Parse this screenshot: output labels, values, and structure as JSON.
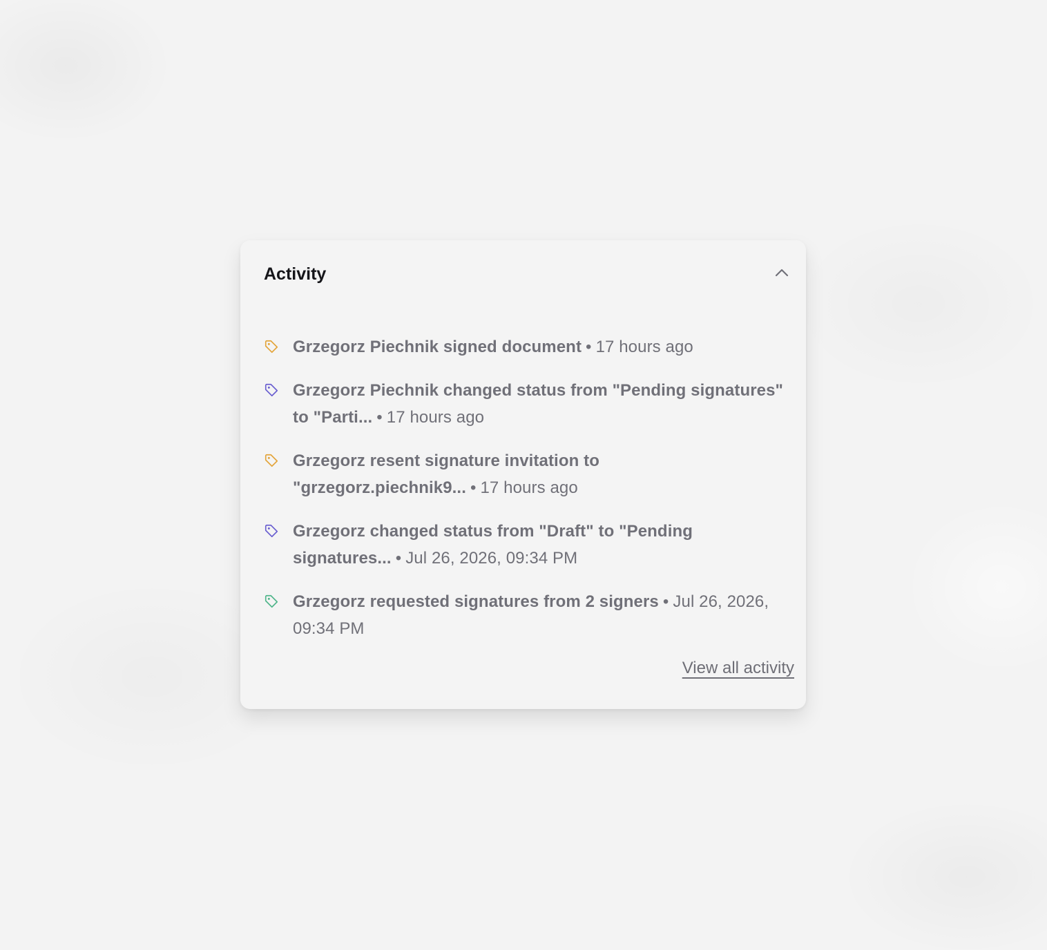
{
  "panel": {
    "title": "Activity",
    "collapse_icon": "chevron-up-icon"
  },
  "activities": [
    {
      "icon": "tag-icon",
      "icon_color": "#e3a43a",
      "action": "Grzegorz Piechnik signed document",
      "time": "17 hours ago"
    },
    {
      "icon": "tag-icon",
      "icon_color": "#6a5fd0",
      "action": "Grzegorz Piechnik changed status from \"Pending signatures\" to \"Parti...",
      "time": "17 hours ago"
    },
    {
      "icon": "tag-icon",
      "icon_color": "#e3a43a",
      "action": "Grzegorz resent signature invitation to \"grzegorz.piechnik9...",
      "time": "17 hours ago"
    },
    {
      "icon": "tag-icon",
      "icon_color": "#6a5fd0",
      "action": "Grzegorz changed status from \"Draft\" to \"Pending signatures...",
      "time": "Jul 26, 2026, 09:34 PM"
    },
    {
      "icon": "tag-icon",
      "icon_color": "#4fb58a",
      "action": "Grzegorz requested signatures from 2 signers",
      "time": "Jul 26, 2026, 09:34 PM"
    }
  ],
  "footer": {
    "view_all_label": "View all activity"
  }
}
